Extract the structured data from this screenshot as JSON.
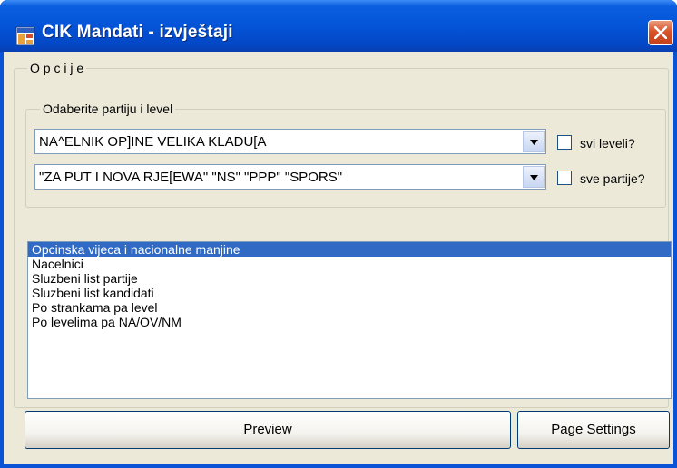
{
  "window": {
    "title": "CIK Mandati - izvještaji"
  },
  "options_group": {
    "legend": "O p c i j e"
  },
  "selection_group": {
    "legend": "Odaberite partiju i level",
    "level_combo": {
      "value": "NA^ELNIK OP]INE VELIKA KLADU[A"
    },
    "party_combo": {
      "value": "\"ZA PUT I NOVA RJE[EWA\" \"NS\" \"PPP\" \"SPORS\""
    },
    "all_levels_checkbox": {
      "label": "svi leveli?",
      "checked": false
    },
    "all_parties_checkbox": {
      "label": "sve partije?",
      "checked": false
    }
  },
  "report_list": {
    "items": [
      "Opcinska vijeca i nacionalne manjine",
      "Nacelnici",
      "Sluzbeni list partije",
      "Sluzbeni list kandidati",
      "Po strankama pa level",
      "Po levelima pa NA/OV/NM"
    ],
    "selected_index": 0
  },
  "buttons": {
    "preview": "Preview",
    "page_settings": "Page Settings"
  },
  "colors": {
    "title_bar": "#0454d8",
    "client_bg": "#ece9d8",
    "selection": "#316ac5",
    "close_button": "#d9542a"
  }
}
